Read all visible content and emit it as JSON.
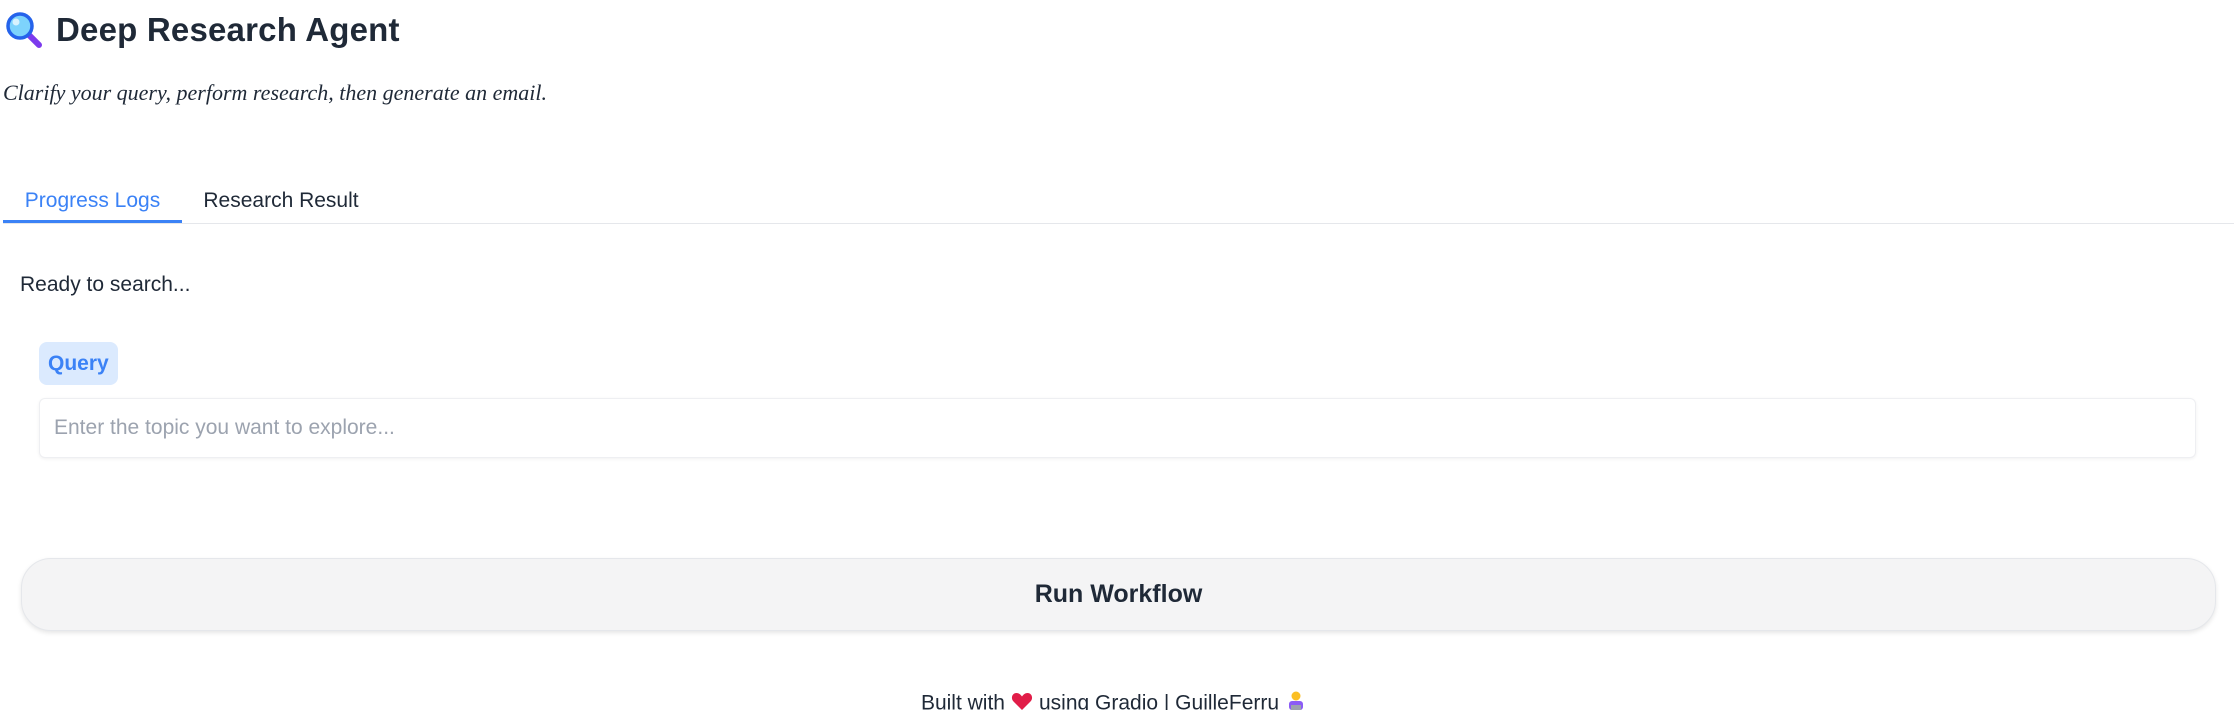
{
  "header": {
    "icon": "magnifying-glass-icon",
    "title": "Deep Research Agent",
    "subtitle": "Clarify your query, perform research, then generate an email."
  },
  "tabs": [
    {
      "label": "Progress Logs",
      "active": true
    },
    {
      "label": "Research Result",
      "active": false
    }
  ],
  "status": {
    "text": "Ready to search..."
  },
  "query": {
    "label": "Query",
    "value": "",
    "placeholder": "Enter the topic you want to explore..."
  },
  "actions": {
    "run_label": "Run Workflow"
  },
  "footer": {
    "text_before": "Built with",
    "heart_icon": "heart-icon",
    "text_after": "using Gradio | GuilleFerru",
    "person_icon": "technologist-icon"
  },
  "colors": {
    "accent": "#3b82f6",
    "label_bg": "#dbeafe",
    "button_bg": "#f4f4f5",
    "heart": "#e11d48"
  }
}
